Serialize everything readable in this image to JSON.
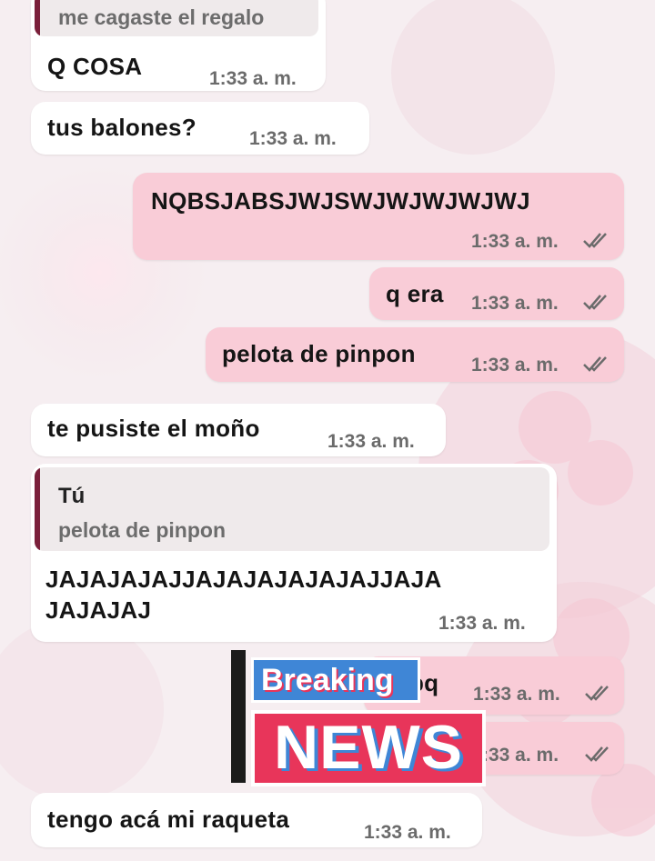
{
  "messages": [
    {
      "id": "m1",
      "reply_quote": "me cagaste el regalo",
      "text": "Q COSA",
      "time": "1:33 a. m."
    },
    {
      "id": "m2",
      "text": "tus balones?",
      "time": "1:33 a. m."
    },
    {
      "id": "m3",
      "text": "NQBSJABSJWJSWJWJWJWJWJ",
      "time": "1:33 a. m.",
      "status": "read"
    },
    {
      "id": "m4",
      "text": "q era",
      "time": "1:33 a. m.",
      "status": "read"
    },
    {
      "id": "m5",
      "text": "pelota de pinpon",
      "time": "1:33 a. m.",
      "status": "read"
    },
    {
      "id": "m6",
      "text": "te pusiste el moño",
      "time": "1:33 a. m."
    },
    {
      "id": "m7",
      "reply_author": "Tú",
      "reply_quote": "pelota de pinpon",
      "text_line1": "JAJAJAJAJJAJAJAJAJAJAJJAJA",
      "text_line2": "JAJAJAJ",
      "time": "1:33 a. m."
    },
    {
      "id": "m8",
      "text_partial": "bq",
      "time": "1:33 a. m.",
      "status": "read"
    },
    {
      "id": "m9",
      "text_partial": ":33 a. m.",
      "status": "read"
    },
    {
      "id": "m10",
      "text": "tengo acá mi raqueta",
      "time": "1:33 a. m."
    }
  ],
  "sticker": {
    "top_text": "Breaking",
    "bottom_text": "NEWS"
  },
  "colors": {
    "incoming": "#ffffff",
    "outgoing": "#f9ccd7",
    "quote_bar": "#7a1f3a",
    "sticker_blue": "#3f86d6",
    "sticker_red": "#e8355a"
  },
  "icons": {
    "read_status": "double-check-icon"
  }
}
